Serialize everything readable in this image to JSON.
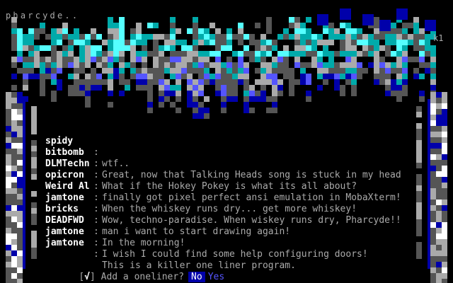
{
  "header": {
    "brand": "pharcyde..",
    "art_tag": "k1"
  },
  "colors": {
    "background": "#000000",
    "handle": "#ffffff",
    "message": "#aaaaaa",
    "cyan": "#55ffff",
    "dark_cyan": "#00aaaa",
    "blue": "#5555ff",
    "dark_blue": "#0000aa",
    "light_gray": "#aaaaaa",
    "dark_gray": "#555555",
    "selected_option_bg": "#0000aa"
  },
  "oneliners": [
    {
      "handle": "spidy",
      "message": "wtf.."
    },
    {
      "handle": "bitbomb",
      "message": "Great, now that Talking Heads song is stuck in my head"
    },
    {
      "handle": "DLMTechn",
      "message": "What if the Hokey Pokey is what its all about?"
    },
    {
      "handle": "opicron",
      "message": "finally got pixel perfect ansi emulation in MobaXterm!"
    },
    {
      "handle": "Weird Al",
      "message": "When the whiskey runs dry... get more whiskey!"
    },
    {
      "handle": "jamtone",
      "message": "Wow, techno-paradise. When wiskey runs dry, Pharcyde!!"
    },
    {
      "handle": "bricks",
      "message": "man i want to start drawing again!"
    },
    {
      "handle": "DEADFWD",
      "message": "In the morning!"
    },
    {
      "handle": "jamtone",
      "message": "I wish I could find some help configuring doors!"
    },
    {
      "handle": "jamtone",
      "message": "This is a killer one liner program."
    }
  ],
  "separator": ":",
  "prompt": {
    "checkbox_open": "[",
    "checkbox_mark": "√",
    "checkbox_close": "]",
    "question": "Add a oneliner?",
    "option_no": "No",
    "option_yes": "Yes",
    "selected": "No"
  }
}
